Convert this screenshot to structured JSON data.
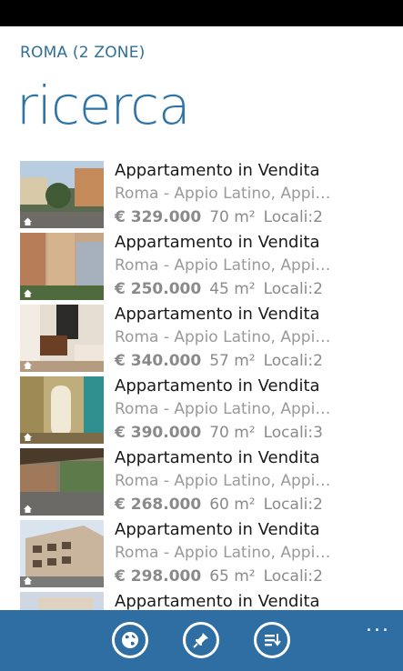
{
  "header": {
    "subtitle": "ROMA (2 ZONE)",
    "title": "ricerca"
  },
  "listings": [
    {
      "title": "Appartamento in Vendita",
      "address": "Roma - Appio Latino, Appia...",
      "price": "€ 329.000",
      "area": "70 m²",
      "rooms": "Locali:2"
    },
    {
      "title": "Appartamento in Vendita",
      "address": "Roma - Appio Latino, Appia...",
      "price": "€ 250.000",
      "area": "45 m²",
      "rooms": "Locali:2"
    },
    {
      "title": "Appartamento in Vendita",
      "address": "Roma - Appio Latino, Appia...",
      "price": "€ 340.000",
      "area": "57 m²",
      "rooms": "Locali:2"
    },
    {
      "title": "Appartamento in Vendita",
      "address": "Roma - Appio Latino, Appia...",
      "price": "€ 390.000",
      "area": "70 m²",
      "rooms": "Locali:3"
    },
    {
      "title": "Appartamento in Vendita",
      "address": "Roma - Appio Latino, Appia...",
      "price": "€ 268.000",
      "area": "60 m²",
      "rooms": "Locali:2"
    },
    {
      "title": "Appartamento in Vendita",
      "address": "Roma - Appio Latino, Appia...",
      "price": "€ 298.000",
      "area": "65 m²",
      "rooms": "Locali:2"
    },
    {
      "title": "Appartamento in Vendita",
      "address": "",
      "price": "",
      "area": "",
      "rooms": ""
    }
  ],
  "app_bar": {
    "buttons": [
      {
        "icon": "globe-icon"
      },
      {
        "icon": "pin-icon"
      },
      {
        "icon": "list-sort-icon"
      }
    ],
    "more_label": "..."
  },
  "colors": {
    "accent": "#2f74a6",
    "app_bar": "#2e6ea3"
  }
}
